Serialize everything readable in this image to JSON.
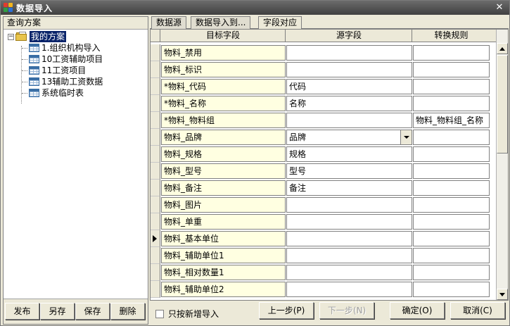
{
  "window": {
    "title": "数据导入",
    "close_glyph": "✕"
  },
  "left_panel": {
    "header": "查询方案",
    "tree": {
      "expander": "−",
      "root": "我的方案",
      "items": [
        "1.组织机构导入",
        "10工资辅助项目",
        "11工资项目",
        "13辅助工资数据",
        "系统临时表"
      ]
    },
    "buttons": {
      "publish": "发布",
      "save_as": "另存",
      "save": "保存",
      "delete": "删除"
    }
  },
  "tabs": [
    "数据源",
    "数据导入到...",
    "字段对应"
  ],
  "grid": {
    "headers": {
      "target": "目标字段",
      "source": "源字段",
      "rule": "转换规则"
    },
    "rows": [
      {
        "target": "物料_禁用",
        "source": "",
        "rule": ""
      },
      {
        "target": "物料_标识",
        "source": "",
        "rule": ""
      },
      {
        "target": "*物料_代码",
        "source": "代码",
        "rule": ""
      },
      {
        "target": "*物料_名称",
        "source": "名称",
        "rule": ""
      },
      {
        "target": "*物料_物料组",
        "source": "",
        "rule": "物料_物料组_名称"
      },
      {
        "target": "物料_品牌",
        "source": "品牌",
        "rule": ""
      },
      {
        "target": "物料_规格",
        "source": "规格",
        "rule": ""
      },
      {
        "target": "物料_型号",
        "source": "型号",
        "rule": ""
      },
      {
        "target": "物料_备注",
        "source": "备注",
        "rule": ""
      },
      {
        "target": "物料_图片",
        "source": "",
        "rule": ""
      },
      {
        "target": "物料_单重",
        "source": "",
        "rule": ""
      },
      {
        "target": "物料_基本单位",
        "source": "",
        "rule": ""
      },
      {
        "target": "物料_辅助单位1",
        "source": "",
        "rule": ""
      },
      {
        "target": "物料_相对数量1",
        "source": "",
        "rule": ""
      },
      {
        "target": "物料_辅助单位2",
        "source": "",
        "rule": ""
      }
    ]
  },
  "bottom": {
    "checkbox_label": "只按新增导入",
    "prev_button": "上一步(P)",
    "next_button": "下一步(N)",
    "ok_button": "确定(O)",
    "cancel_button": "取消(C)"
  },
  "colors": {
    "target_cell_bg": "#ffffe1",
    "selection": "#0a246a"
  }
}
